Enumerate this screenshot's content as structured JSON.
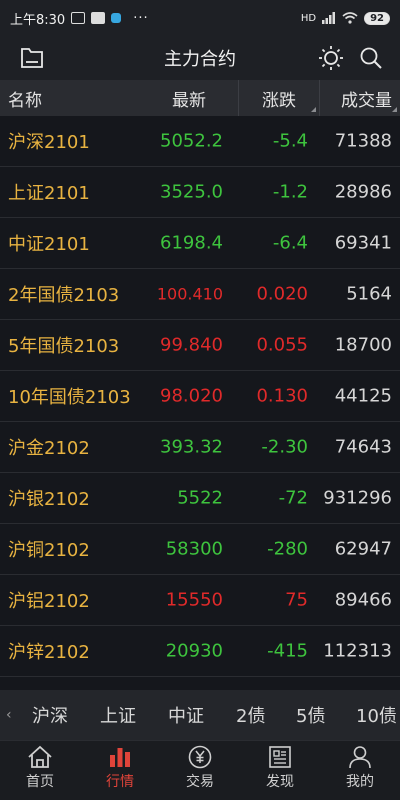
{
  "status_bar": {
    "time": "上午8:30",
    "more": "···",
    "network": "HD",
    "battery": "92"
  },
  "header": {
    "title": "主力合约"
  },
  "columns": {
    "name": "名称",
    "latest": "最新",
    "change": "涨跌",
    "volume": "成交量"
  },
  "rows": [
    {
      "name": "沪深2101",
      "price": "5052.2",
      "change": "-5.4",
      "volume": "71388"
    },
    {
      "name": "上证2101",
      "price": "3525.0",
      "change": "-1.2",
      "volume": "28986"
    },
    {
      "name": "中证2101",
      "price": "6198.4",
      "change": "-6.4",
      "volume": "69341"
    },
    {
      "name": "2年国债2103",
      "price": "100.410",
      "change": "0.020",
      "volume": "5164"
    },
    {
      "name": "5年国债2103",
      "price": "99.840",
      "change": "0.055",
      "volume": "18700"
    },
    {
      "name": "10年国债2103",
      "price": "98.020",
      "change": "0.130",
      "volume": "44125"
    },
    {
      "name": "沪金2102",
      "price": "393.32",
      "change": "-2.30",
      "volume": "74643"
    },
    {
      "name": "沪银2102",
      "price": "5522",
      "change": "-72",
      "volume": "931296"
    },
    {
      "name": "沪铜2102",
      "price": "58300",
      "change": "-280",
      "volume": "62947"
    },
    {
      "name": "沪铝2102",
      "price": "15550",
      "change": "75",
      "volume": "89466"
    },
    {
      "name": "沪锌2102",
      "price": "20930",
      "change": "-415",
      "volume": "112313"
    }
  ],
  "categories": [
    "沪深",
    "上证",
    "中证",
    "2债",
    "5债",
    "10债"
  ],
  "tabs": [
    {
      "label": "首页",
      "icon": "home-icon"
    },
    {
      "label": "行情",
      "icon": "market-chart-icon"
    },
    {
      "label": "交易",
      "icon": "yuan-icon"
    },
    {
      "label": "发现",
      "icon": "news-icon"
    },
    {
      "label": "我的",
      "icon": "user-icon"
    }
  ],
  "colors": {
    "up": "#e02a2a",
    "down": "#3ec43e",
    "name": "#e8b341",
    "active_tab": "#e0443a"
  }
}
